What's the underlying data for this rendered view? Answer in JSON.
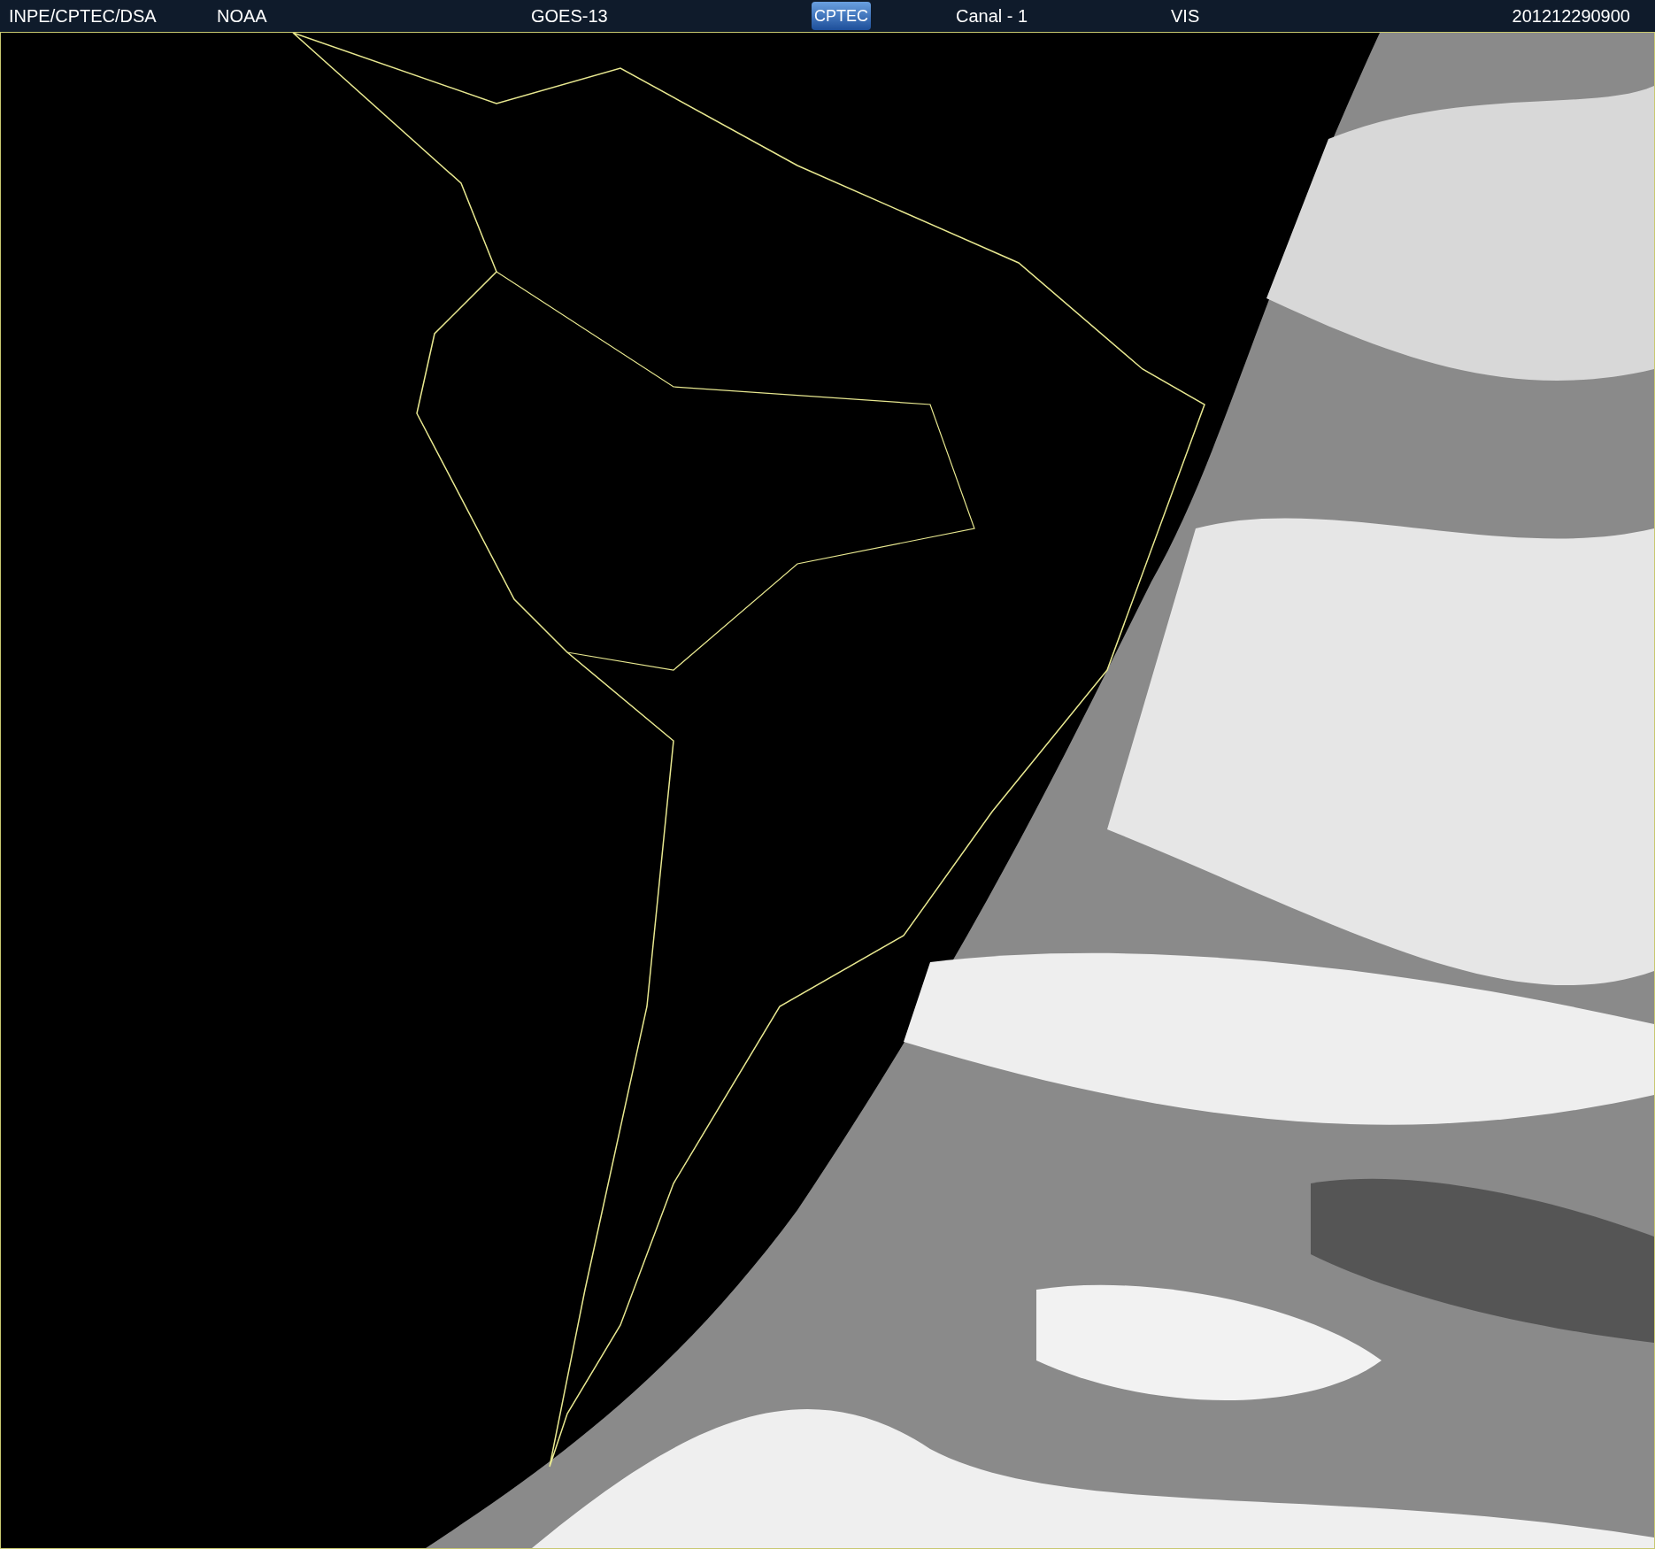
{
  "header": {
    "source": "INPE/CPTEC/DSA",
    "agency": "NOAA",
    "satellite": "GOES-13",
    "logo": "CPTEC",
    "channel": "Canal - 1",
    "band": "VIS",
    "timestamp": "201212290900"
  }
}
